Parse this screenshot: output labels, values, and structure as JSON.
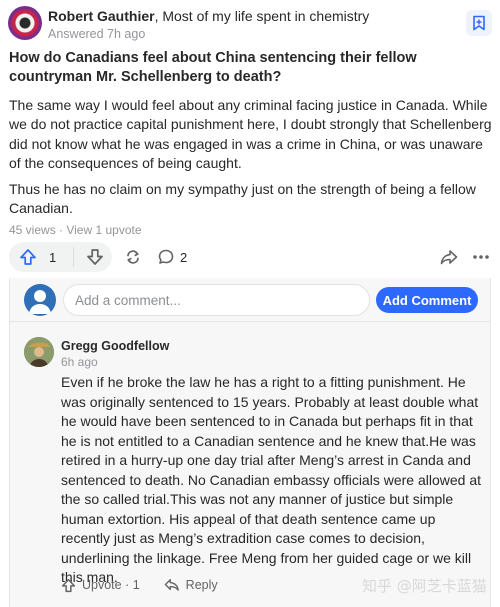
{
  "answer": {
    "author_name": "Robert Gauthier",
    "author_credential": ", Most of my life spent in chemistry",
    "answered_time": "Answered 7h ago",
    "question": "How do Canadians feel about China sentencing their fellow countryman Mr. Schellenberg to death?",
    "paragraphs": [
      "The same way I would feel about any criminal facing justice in Canada. While we do not practice capital punishment here, I doubt strongly that Schellenberg did not know what he was engaged in was a crime in China, or was unaware of the consequences of being caught.",
      "Thus he has no claim on my sympathy just on the strength of being a fellow Canadian."
    ],
    "stats": "45 views · View 1 upvote"
  },
  "actions": {
    "upvote_count": "1",
    "comment_count": "2"
  },
  "comment_box": {
    "placeholder": "Add a comment...",
    "button_label": "Add Comment"
  },
  "comments": [
    {
      "author": "Gregg Goodfellow",
      "time": "6h ago",
      "text": "Even if he broke the law he has a right to a fitting punishment. He was originally sentenced to 15 years. Probably at least double what he would have been sentenced to in Canada but perhaps fit in that he is not entitled to a Canadian sentence and he knew that.He was retired in a hurry-up one day trial after Meng’s arrest in Canda and sentenced to death. No Canadian embassy officials were allowed at the so called trial.This was not any manner of justice but simple human extortion. His appeal of that death sentence came up recently just as Meng’s extradition case comes to decision, underlining the linkage. Free Meng from her guided cage or we kill this man.",
      "upvote_label": "Upvote · 1",
      "reply_label": "Reply"
    }
  ],
  "watermark": "知乎 @阿芝卡蓝猫",
  "colors": {
    "accent": "#2e69ff",
    "upvote_icon": "#2e69ff",
    "text": "#282829",
    "muted": "#939598"
  },
  "icons": [
    "bookmark-icon",
    "upvote-arrow-icon",
    "downvote-arrow-icon",
    "share-loop-icon",
    "comment-bubble-icon",
    "forward-icon",
    "more-dots-icon",
    "user-silhouette-icon",
    "reply-icon"
  ]
}
